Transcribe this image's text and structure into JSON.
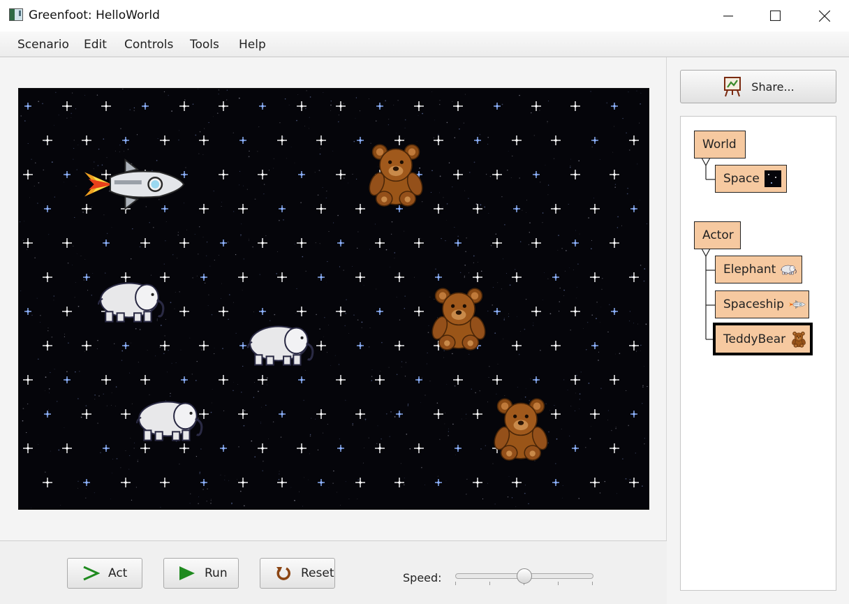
{
  "window": {
    "title": "Greenfoot: HelloWorld"
  },
  "menu": {
    "items": [
      "Scenario",
      "Edit",
      "Controls",
      "Tools",
      "Help"
    ]
  },
  "world": {
    "background": "starfield",
    "actors": [
      "spaceship",
      "teddybear",
      "teddybear",
      "teddybear",
      "elephant",
      "elephant",
      "elephant"
    ]
  },
  "controls": {
    "act_label": "Act",
    "run_label": "Run",
    "reset_label": "Reset",
    "speed_label": "Speed:",
    "speed_value": 0.5
  },
  "share": {
    "label": "Share..."
  },
  "class_tree": {
    "world_classes": [
      {
        "name": "World",
        "icon": null
      },
      {
        "name": "Space",
        "icon": "space-thumb-icon"
      }
    ],
    "actor_classes": [
      {
        "name": "Actor",
        "icon": null
      },
      {
        "name": "Elephant",
        "icon": "elephant-thumb-icon"
      },
      {
        "name": "Spaceship",
        "icon": "spaceship-thumb-icon"
      },
      {
        "name": "TeddyBear",
        "icon": "teddybear-thumb-icon",
        "selected": true
      }
    ]
  },
  "colors": {
    "class_fill": "#f6c9a0",
    "world_bg": "#05050a",
    "run_icon": "#1f8a1f",
    "act_icon": "#1f8a1f",
    "reset_icon": "#8b4513"
  }
}
